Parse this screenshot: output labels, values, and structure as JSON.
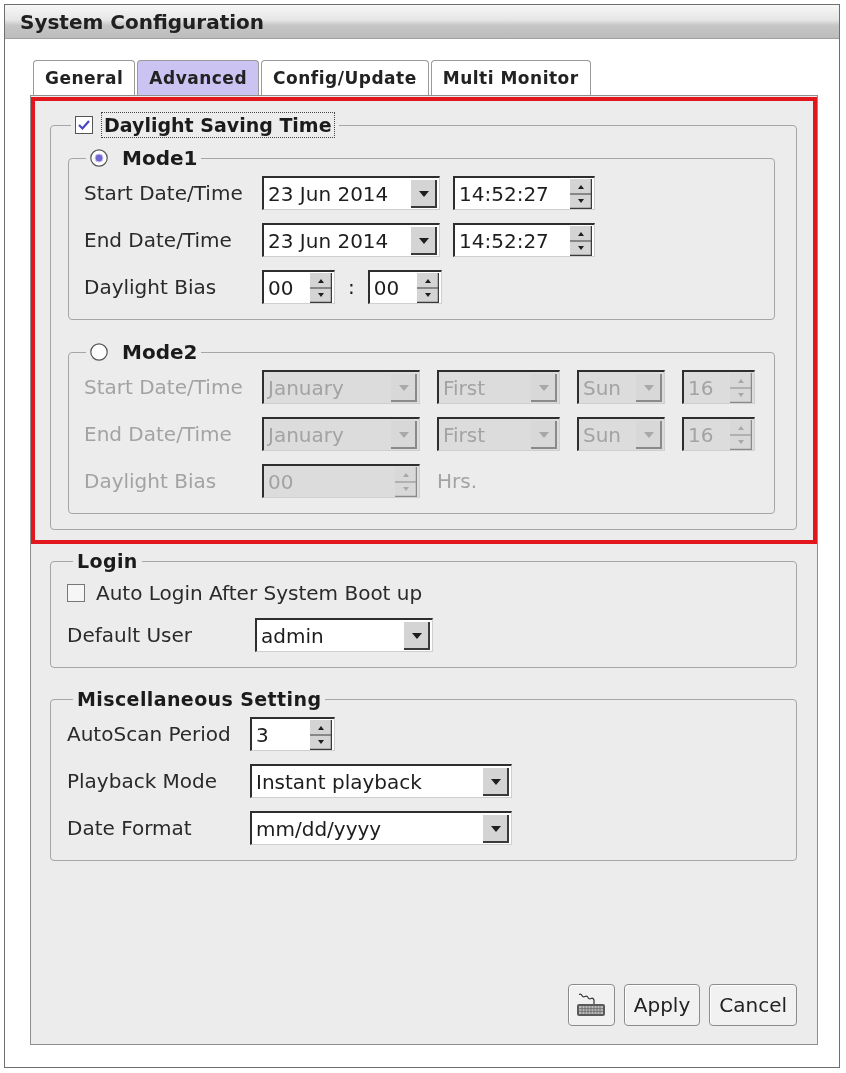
{
  "window": {
    "title": "System Configuration"
  },
  "tabs": [
    {
      "label": "General",
      "selected": false
    },
    {
      "label": "Advanced",
      "selected": true
    },
    {
      "label": "Config/Update",
      "selected": false
    },
    {
      "label": "Multi Monitor",
      "selected": false
    }
  ],
  "daylight_saving": {
    "label": "Daylight Saving Time",
    "checked": true,
    "focused": true,
    "highlighted": true,
    "modes": [
      {
        "label": "Mode1",
        "selected": true,
        "rows": [
          {
            "label": "Start Date/Time",
            "disabled": false,
            "controls": [
              {
                "kind": "dropdown",
                "value": "23 Jun 2014"
              },
              {
                "kind": "spinner",
                "value": "14:52:27"
              }
            ]
          },
          {
            "label": "End Date/Time",
            "disabled": false,
            "controls": [
              {
                "kind": "dropdown",
                "value": "23 Jun 2014"
              },
              {
                "kind": "spinner",
                "value": "14:52:27"
              }
            ]
          },
          {
            "label": "Daylight Bias",
            "disabled": false,
            "controls": [
              {
                "kind": "spinner",
                "value": "00"
              },
              {
                "kind": "text",
                "value": ":"
              },
              {
                "kind": "spinner",
                "value": "00"
              }
            ]
          }
        ]
      },
      {
        "label": "Mode2",
        "selected": false,
        "rows": [
          {
            "label": "Start Date/Time",
            "disabled": true,
            "controls": [
              {
                "kind": "dropdown",
                "value": "January"
              },
              {
                "kind": "dropdown",
                "value": "First"
              },
              {
                "kind": "dropdown",
                "value": "Sun"
              },
              {
                "kind": "spinner",
                "value": "16"
              }
            ]
          },
          {
            "label": "End Date/Time",
            "disabled": true,
            "controls": [
              {
                "kind": "dropdown",
                "value": "January"
              },
              {
                "kind": "dropdown",
                "value": "First"
              },
              {
                "kind": "dropdown",
                "value": "Sun"
              },
              {
                "kind": "spinner",
                "value": "16"
              }
            ]
          },
          {
            "label": "Daylight Bias",
            "disabled": true,
            "controls": [
              {
                "kind": "spinner",
                "value": "00"
              },
              {
                "kind": "text",
                "value": "Hrs."
              }
            ]
          }
        ]
      }
    ]
  },
  "login": {
    "title": "Login",
    "rows": [
      {
        "kind": "checkbox",
        "label": "Auto Login After System Boot up",
        "checked": false
      },
      {
        "kind": "dropdown",
        "label": "Default User",
        "value": "admin"
      }
    ]
  },
  "misc": {
    "title": "Miscellaneous Setting",
    "rows": [
      {
        "kind": "spinner",
        "label": "AutoScan Period",
        "value": "3"
      },
      {
        "kind": "dropdown",
        "label": "Playback Mode",
        "value": "Instant playback"
      },
      {
        "kind": "dropdown",
        "label": "Date Format",
        "value": "mm/dd/yyyy"
      }
    ]
  },
  "buttons": [
    {
      "kind": "icon"
    },
    {
      "kind": "text",
      "label": "Apply"
    },
    {
      "kind": "text",
      "label": "Cancel"
    }
  ]
}
